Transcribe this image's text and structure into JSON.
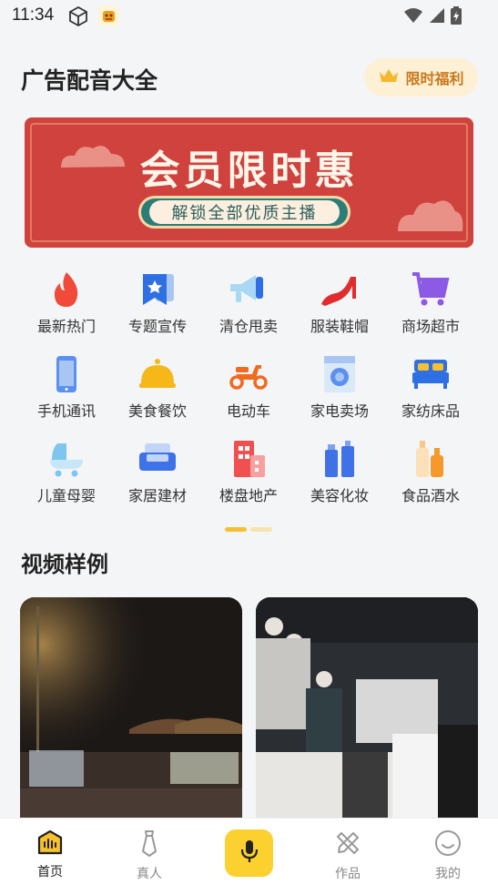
{
  "status_bar": {
    "time": "11:34"
  },
  "header": {
    "title": "广告配音大全",
    "benefit_label": "限时福利"
  },
  "banner": {
    "title": "会员限时惠",
    "subtitle": "解锁全部优质主播"
  },
  "categories": [
    {
      "label": "最新热门",
      "icon": "flame-icon"
    },
    {
      "label": "专题宣传",
      "icon": "star-bookmark-icon"
    },
    {
      "label": "清仓甩卖",
      "icon": "megaphone-icon"
    },
    {
      "label": "服装鞋帽",
      "icon": "high-heel-icon"
    },
    {
      "label": "商场超市",
      "icon": "shopping-cart-icon"
    },
    {
      "label": "手机通讯",
      "icon": "phone-icon"
    },
    {
      "label": "美食餐饮",
      "icon": "food-cloche-icon"
    },
    {
      "label": "电动车",
      "icon": "scooter-icon"
    },
    {
      "label": "家电卖场",
      "icon": "washing-machine-icon"
    },
    {
      "label": "家纺床品",
      "icon": "bed-icon"
    },
    {
      "label": "儿童母婴",
      "icon": "stroller-icon"
    },
    {
      "label": "家居建材",
      "icon": "sofa-icon"
    },
    {
      "label": "楼盘地产",
      "icon": "building-icon"
    },
    {
      "label": "美容化妆",
      "icon": "cosmetics-icon"
    },
    {
      "label": "食品酒水",
      "icon": "bottles-icon"
    }
  ],
  "section": {
    "title": "视频样例"
  },
  "nav": {
    "home": "首页",
    "person": "真人",
    "works": "作品",
    "mine": "我的"
  },
  "colors": {
    "accent": "#fcd02f",
    "banner_red": "#d0423e",
    "benefit_text": "#c8781a"
  }
}
